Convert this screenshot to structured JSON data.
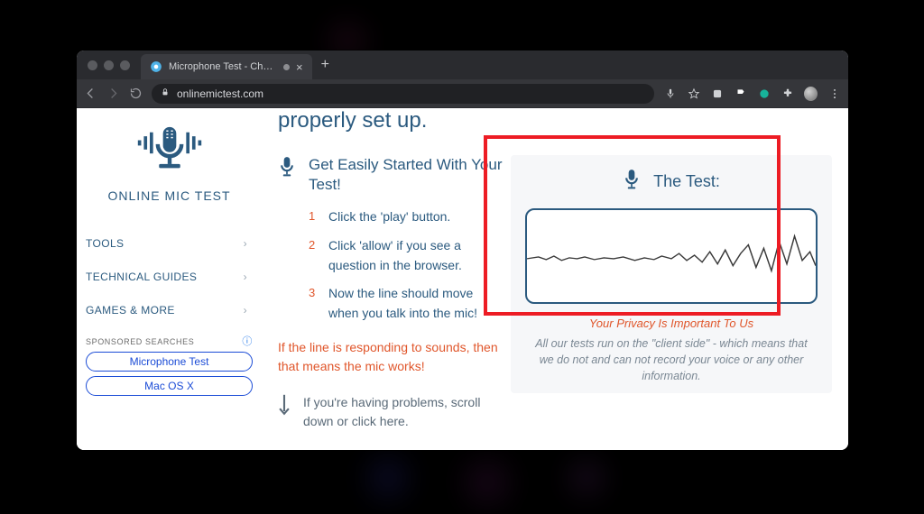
{
  "browser": {
    "tab_title": "Microphone Test - Check",
    "url": "onlinemictest.com"
  },
  "sidebar": {
    "brand": "ONLINE MIC TEST",
    "nav": [
      {
        "label": "TOOLS"
      },
      {
        "label": "TECHNICAL GUIDES"
      },
      {
        "label": "GAMES & MORE"
      }
    ],
    "sponsored_label": "SPONSORED SEARCHES",
    "ads": [
      {
        "label": "Microphone Test"
      },
      {
        "label": "Mac OS X"
      }
    ]
  },
  "main": {
    "cut_heading": "properly set up.",
    "gs_title": "Get Easily Started With Your Test!",
    "steps": [
      {
        "n": "1",
        "text": "Click the 'play' button."
      },
      {
        "n": "2",
        "text": "Click 'allow' if you see a question in the browser."
      },
      {
        "n": "3",
        "text": "Now the line should move when you talk into the mic!"
      }
    ],
    "responding": "If the line is responding to sounds, then that means the mic works!",
    "problems": "If you're having problems, scroll down or click here.",
    "test_label": "The Test:",
    "privacy_head": "Your Privacy Is Important To Us",
    "privacy_text": "All our tests run on the \"client side\" - which means that we do not and can not record your voice or any other information."
  },
  "colors": {
    "brand_blue": "#2b5a7f",
    "accent_orange": "#e0562b",
    "highlight_red": "#ed1c24",
    "ad_blue": "#1a4bd6"
  }
}
